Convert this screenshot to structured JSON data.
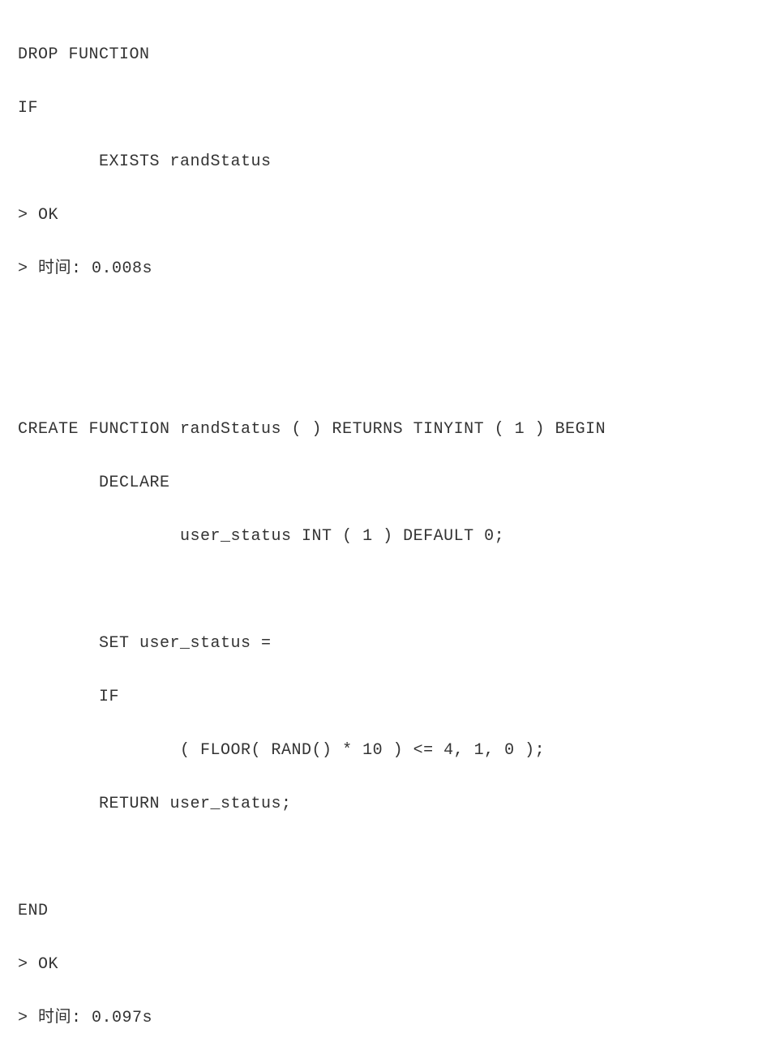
{
  "query1": {
    "line1": "DROP FUNCTION",
    "line2": "IF",
    "line3": "        EXISTS randStatus"
  },
  "result1": {
    "status": "> OK",
    "time": "> 时间: 0.008s"
  },
  "query2": {
    "line1": "CREATE FUNCTION randStatus ( ) RETURNS TINYINT ( 1 ) BEGIN",
    "line2": "        DECLARE",
    "line3": "                user_status INT ( 1 ) DEFAULT 0;",
    "line4": "        ",
    "line5": "        SET user_status =",
    "line6": "        IF",
    "line7": "                ( FLOOR( RAND() * 10 ) <= 4, 1, 0 );",
    "line8": "        RETURN user_status;",
    "line9": "        ",
    "line10": "END"
  },
  "result2": {
    "status": "> OK",
    "time": "> 时间: 0.097s"
  }
}
